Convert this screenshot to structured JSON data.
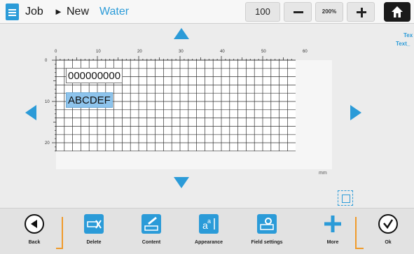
{
  "header": {
    "breadcrumb": [
      "Job",
      "New"
    ],
    "arrow_glyph": "►",
    "job_name": "Water",
    "zoom_value": "100",
    "zoom_percent": "200%",
    "icons": [
      "document-icon",
      "minus-icon",
      "plus-icon",
      "home-icon"
    ]
  },
  "side_labels": [
    "Tex",
    "Text_"
  ],
  "canvas": {
    "x_ticks": [
      "0",
      "10",
      "20",
      "30",
      "40",
      "50",
      "60"
    ],
    "y_ticks": [
      "0",
      "10",
      "20"
    ],
    "unit": "mm",
    "fields": [
      {
        "text": "000000000",
        "selected": false
      },
      {
        "text": "ABCDEF",
        "selected": true
      }
    ]
  },
  "toolbar": {
    "back": "Back",
    "delete": "Delete",
    "content": "Content",
    "appearance": "Appearance",
    "field_settings": "Field settings",
    "more": "More",
    "ok": "Ok"
  },
  "colors": {
    "accent": "#2b9bd8",
    "orange": "#f09a2a",
    "selection": "#8ec4ec"
  }
}
